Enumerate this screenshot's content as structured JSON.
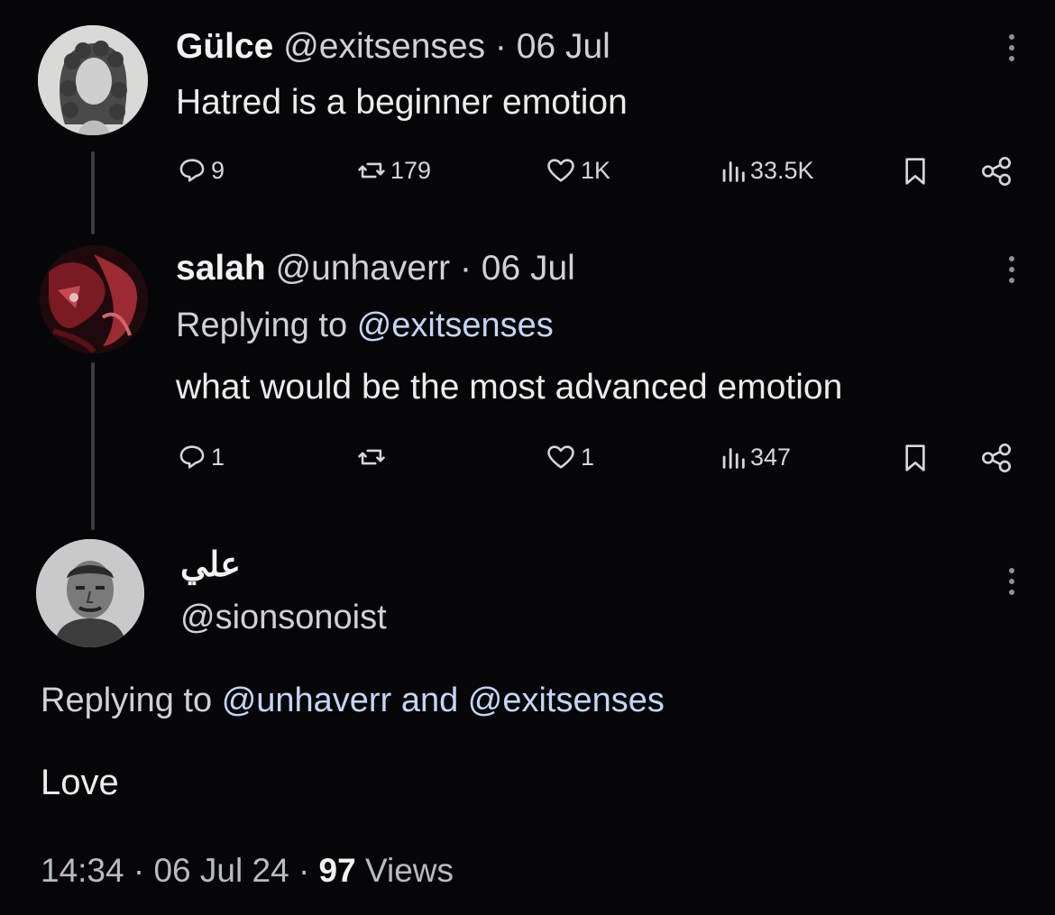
{
  "tweets": [
    {
      "name": "Gülce",
      "handle": "@exitsenses",
      "sep": "·",
      "date": "06 Jul",
      "text": "Hatred is a beginner emotion",
      "replies": "9",
      "retweets": "179",
      "likes": "1K",
      "views": "33.5K",
      "avatar_icon": "curly-hair-portrait-icon"
    },
    {
      "name": "salah",
      "handle": "@unhaverr",
      "sep": "·",
      "date": "06 Jul",
      "replying_prefix": "Replying to",
      "replying_mention": "@exitsenses",
      "text": "what would be the most advanced emotion",
      "replies": "1",
      "retweets": "",
      "likes": "1",
      "views": "347",
      "avatar_icon": "red-painting-portrait-icon"
    }
  ],
  "main_tweet": {
    "name": "علي",
    "handle": "@sionsonoist",
    "replying_prefix": "Replying to",
    "replying_mention1": "@unhaverr",
    "replying_and": "and",
    "replying_mention2": "@exitsenses",
    "text": "Love",
    "time": "14:34",
    "date": "06 Jul 24",
    "views_count": "97",
    "views_label": "Views",
    "avatar_icon": "man-portrait-icon"
  },
  "colors": {
    "background": "#060608",
    "text": "#e7e9ea",
    "mention": "#c3d6f7",
    "muted": "#cfd2d5"
  }
}
